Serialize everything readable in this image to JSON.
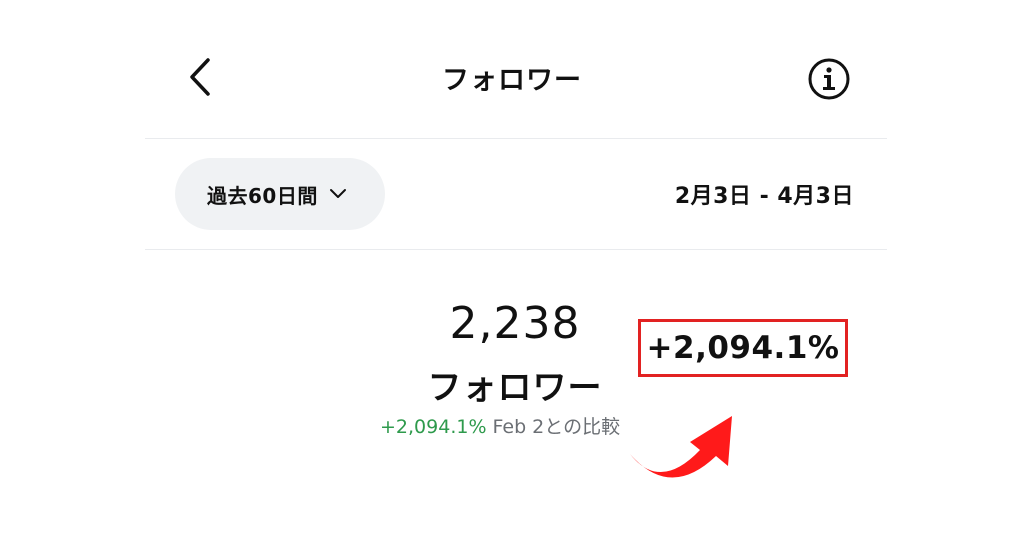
{
  "header": {
    "title": "フォロワー",
    "back_icon": "chevron-left-icon",
    "info_icon": "info-icon"
  },
  "filter": {
    "range_label": "過去60日間",
    "range_icon": "chevron-down-icon",
    "date_range": "2月3日 - 4月3日"
  },
  "stats": {
    "total": "2,238",
    "label": "フォロワー",
    "change_pct": "+2,094.1%",
    "compare_text": "Feb 2との比較"
  },
  "annotation": {
    "highlight_text": "+2,094.1%",
    "border_color": "#e22222",
    "arrow_color": "#ff1a1a",
    "arrow_icon": "curved-arrow-up-icon"
  },
  "colors": {
    "positive": "#2e9a4c",
    "muted": "#6b6f74",
    "pill_bg": "#f0f2f4"
  }
}
